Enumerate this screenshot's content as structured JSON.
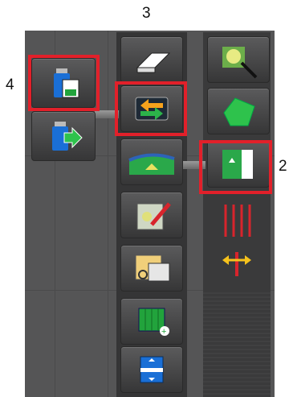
{
  "callouts": {
    "c3": "3",
    "c4": "4",
    "c2": "2"
  },
  "icons": {
    "left": [
      "usb-data-icon",
      "usb-export-icon"
    ],
    "middle": [
      "eraser-icon",
      "swap-icon",
      "terrain-icon",
      "map-edit-icon",
      "map-photo-icon",
      "add-field-icon",
      "align-icon"
    ],
    "right": [
      "sparkle-icon",
      "field-shape-icon",
      "field-boundary-icon",
      "guideline-icon",
      "shift-icon"
    ]
  },
  "colors": {
    "highlight": "#e2202a",
    "panel": "#555556",
    "green": "#22b14c"
  }
}
